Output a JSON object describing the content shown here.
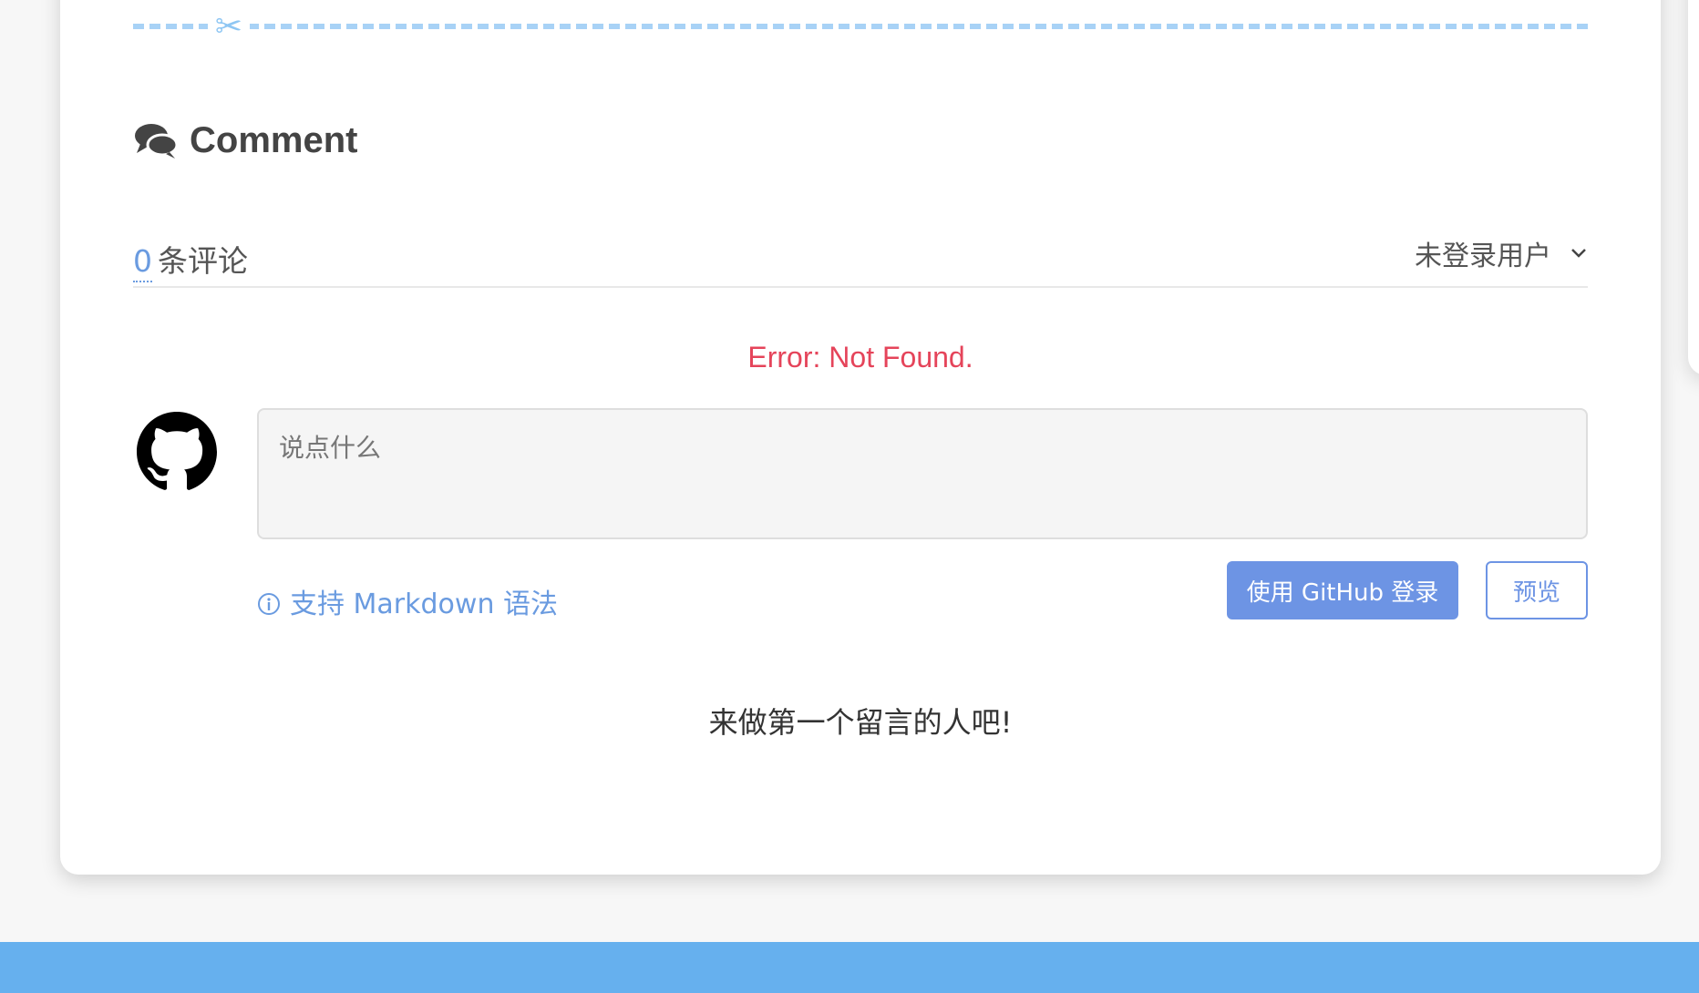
{
  "comment_section": {
    "title": "Comment",
    "count": "0",
    "count_suffix": "条评论",
    "user_label": "未登录用户",
    "error": "Error: Not Found.",
    "input_placeholder": "说点什么",
    "markdown_hint": "支持 Markdown 语法",
    "login_button": "使用 GitHub 登录",
    "preview_button": "预览",
    "empty_message": "来做第一个留言的人吧!"
  },
  "icons": {
    "divider": "scissors-icon",
    "title": "comments-icon",
    "avatar": "github-icon",
    "dropdown": "chevron-down-icon",
    "hint": "info-icon"
  },
  "colors": {
    "accent": "#6d94e4",
    "link": "#6a9be0",
    "error": "#e5445a",
    "divider": "#a8d2f6",
    "footer": "#66b0ee"
  }
}
